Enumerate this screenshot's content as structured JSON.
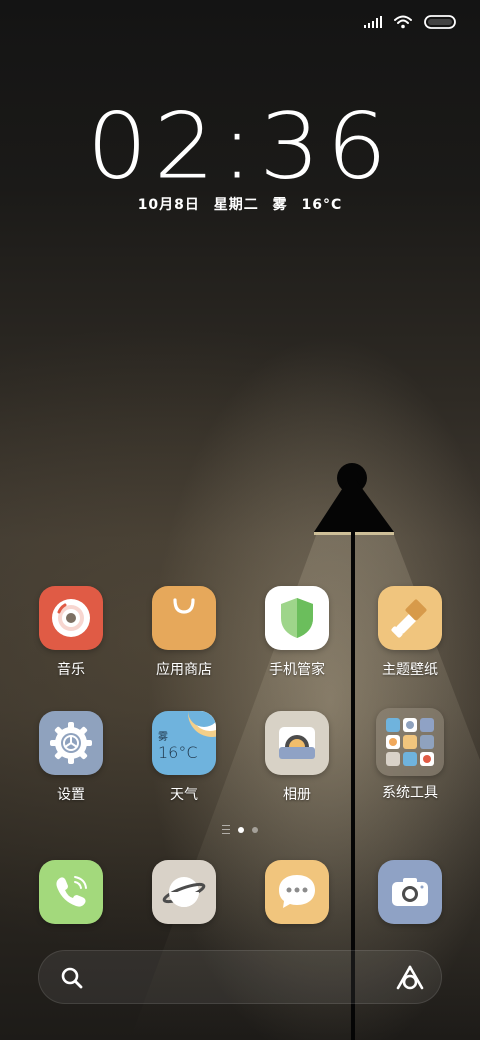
{
  "status_bar": {
    "signal_icon": "signal-bars-icon",
    "wifi_icon": "wifi-icon",
    "battery_icon": "battery-icon"
  },
  "clock": {
    "time": "02:36",
    "date": "10月8日",
    "weekday": "星期二",
    "weather": "雾",
    "temperature": "16°C"
  },
  "apps": [
    {
      "label": "音乐",
      "icon": "music-disc-icon",
      "color": "#E05B45"
    },
    {
      "label": "应用商店",
      "icon": "shopping-bag-icon",
      "color": "#E6A85B"
    },
    {
      "label": "手机管家",
      "icon": "shield-icon",
      "color": "#FFFFFF"
    },
    {
      "label": "主题壁纸",
      "icon": "paint-brush-icon",
      "color": "#F0C57E"
    },
    {
      "label": "设置",
      "icon": "gear-icon",
      "color": "#8FA2BE"
    },
    {
      "label": "天气",
      "icon": "weather-icon",
      "color": "#6FB3DD"
    },
    {
      "label": "相册",
      "icon": "gallery-icon",
      "color": "#D8D2C6"
    },
    {
      "label": "系统工具",
      "icon": "folder-icon",
      "color": "#6C665C"
    }
  ],
  "weather_widget": {
    "condition": "雾",
    "temp": "16°C"
  },
  "dock": [
    {
      "name": "phone",
      "icon": "phone-icon",
      "color": "#A3D97C"
    },
    {
      "name": "browser",
      "icon": "planet-icon",
      "color": "#D9D2C8"
    },
    {
      "name": "messages",
      "icon": "chat-bubble-icon",
      "color": "#F1C57D"
    },
    {
      "name": "camera",
      "icon": "camera-icon",
      "color": "#8FA2C5"
    }
  ],
  "search": {
    "icon": "search-icon",
    "assistant_icon": "assistant-icon"
  },
  "page_indicator": {
    "pages": 2,
    "current": 1
  }
}
